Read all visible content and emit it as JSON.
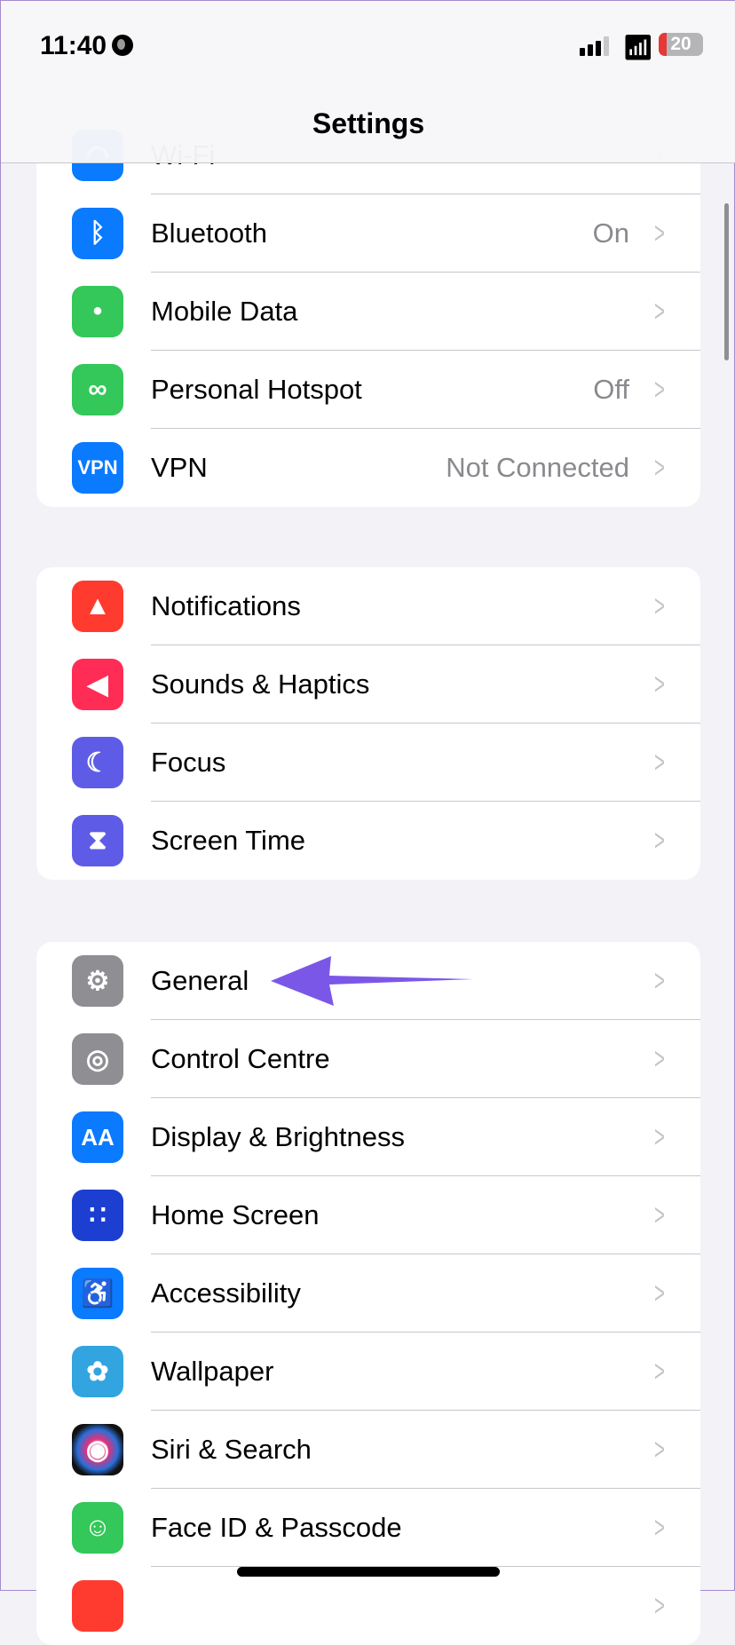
{
  "status_bar": {
    "time": "11:40",
    "battery": "20"
  },
  "header": {
    "title": "Settings"
  },
  "groups": [
    {
      "items": [
        {
          "label": "Wi-Fi",
          "icon": "wifi-icon",
          "color": "#0a7aff"
        },
        {
          "label": "Bluetooth",
          "value": "On",
          "icon": "bluetooth-icon",
          "color": "#0a7aff"
        },
        {
          "label": "Mobile Data",
          "icon": "antenna-icon",
          "color": "#34c759"
        },
        {
          "label": "Personal Hotspot",
          "value": "Off",
          "icon": "hotspot-link-icon",
          "color": "#34c759"
        },
        {
          "label": "VPN",
          "value": "Not Connected",
          "icon": "vpn-icon",
          "icon_text": "VPN",
          "color": "#0a7aff"
        }
      ]
    },
    {
      "items": [
        {
          "label": "Notifications",
          "icon": "bell-icon",
          "color": "#ff3b30"
        },
        {
          "label": "Sounds & Haptics",
          "icon": "speaker-icon",
          "color": "#ff2d55"
        },
        {
          "label": "Focus",
          "icon": "moon-icon",
          "color": "#5e5ce6"
        },
        {
          "label": "Screen Time",
          "icon": "hourglass-icon",
          "color": "#5e5ce6"
        }
      ]
    },
    {
      "items": [
        {
          "label": "General",
          "icon": "gear-icon",
          "color": "#8e8e93"
        },
        {
          "label": "Control Centre",
          "icon": "toggles-icon",
          "color": "#8e8e93"
        },
        {
          "label": "Display & Brightness",
          "icon": "text-size-icon",
          "icon_text": "AA",
          "color": "#0a7aff"
        },
        {
          "label": "Home Screen",
          "icon": "home-grid-icon",
          "color": "#1c3fd1"
        },
        {
          "label": "Accessibility",
          "icon": "accessibility-icon",
          "color": "#0a7aff"
        },
        {
          "label": "Wallpaper",
          "icon": "flower-icon",
          "color": "#32a4e0"
        },
        {
          "label": "Siri & Search",
          "icon": "siri-icon",
          "color": "#222"
        },
        {
          "label": "Face ID & Passcode",
          "icon": "face-id-icon",
          "color": "#34c759"
        },
        {
          "label": "",
          "icon": "sos-icon",
          "color": "#ff3b30"
        }
      ]
    }
  ],
  "annotation": {
    "arrow_color": "#7b57e8",
    "points_to": "General"
  }
}
